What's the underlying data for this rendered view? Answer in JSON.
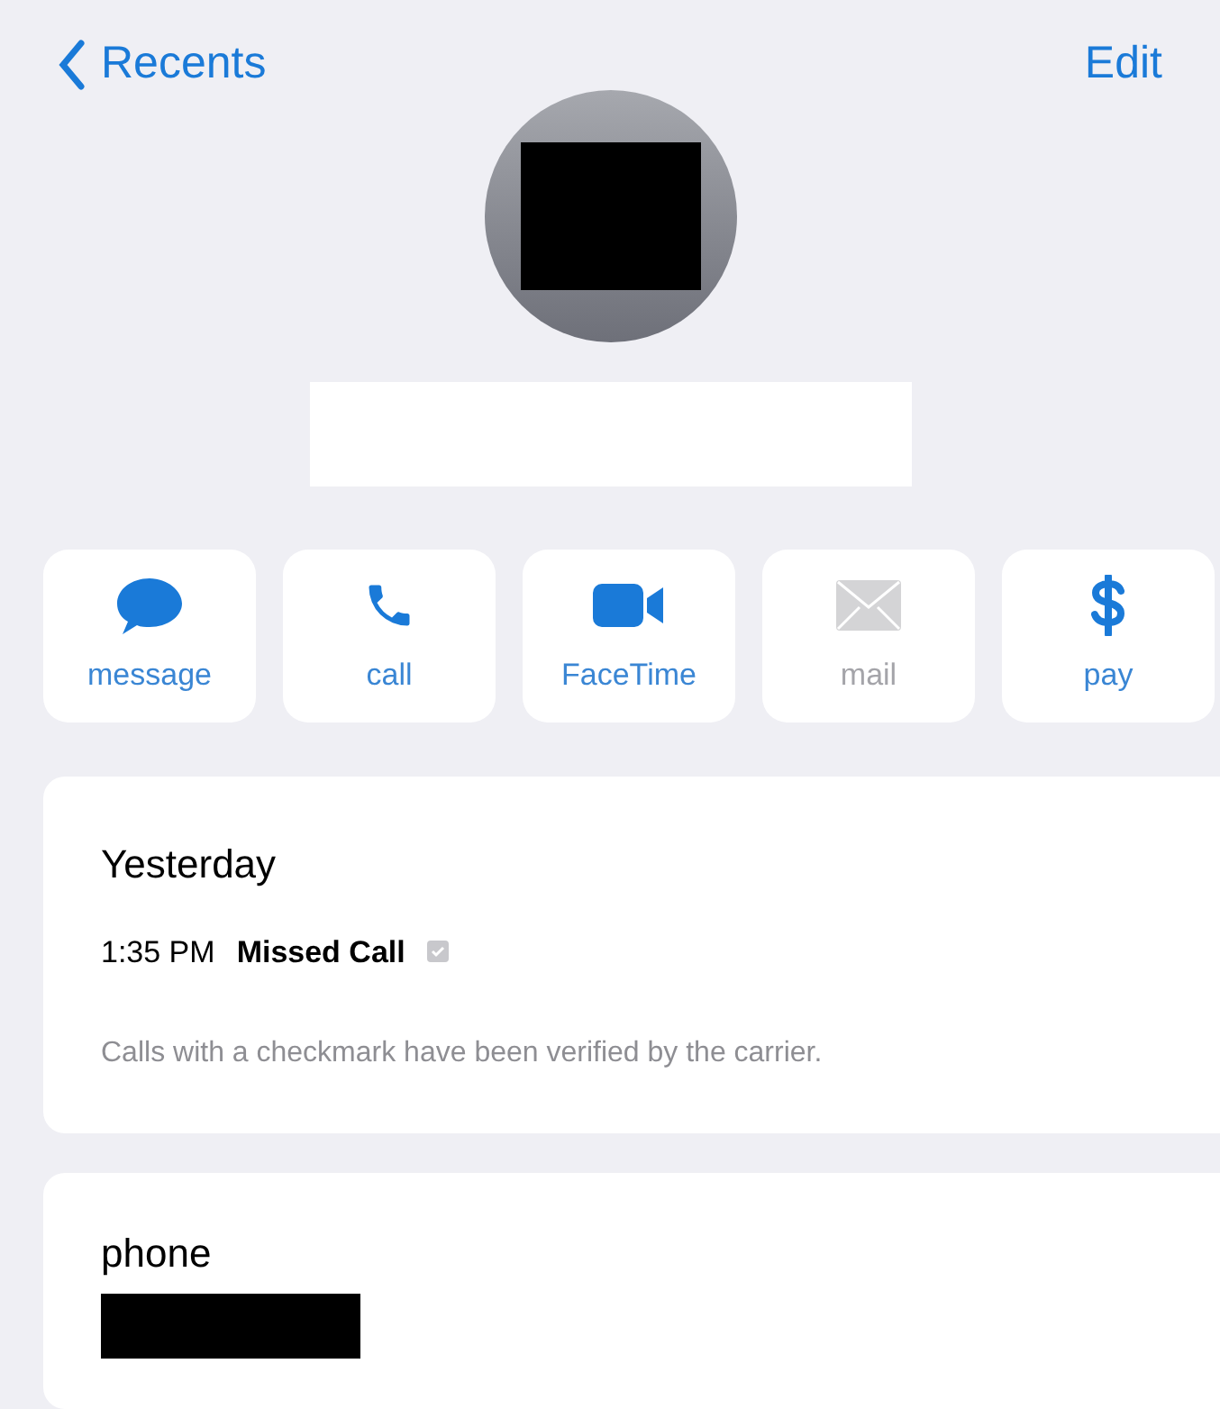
{
  "nav": {
    "back_label": "Recents",
    "edit_label": "Edit"
  },
  "actions": [
    {
      "kind": "message",
      "label": "message",
      "disabled": false
    },
    {
      "kind": "call",
      "label": "call",
      "disabled": false
    },
    {
      "kind": "facetime",
      "label": "FaceTime",
      "disabled": false
    },
    {
      "kind": "mail",
      "label": "mail",
      "disabled": true
    },
    {
      "kind": "pay",
      "label": "pay",
      "disabled": false
    }
  ],
  "recent_calls": {
    "day": "Yesterday",
    "calls": [
      {
        "time": "1:35 PM",
        "type": "Missed Call",
        "verified": true
      }
    ],
    "note": "Calls with a checkmark have been verified by the carrier."
  },
  "phone": {
    "label": "phone"
  }
}
